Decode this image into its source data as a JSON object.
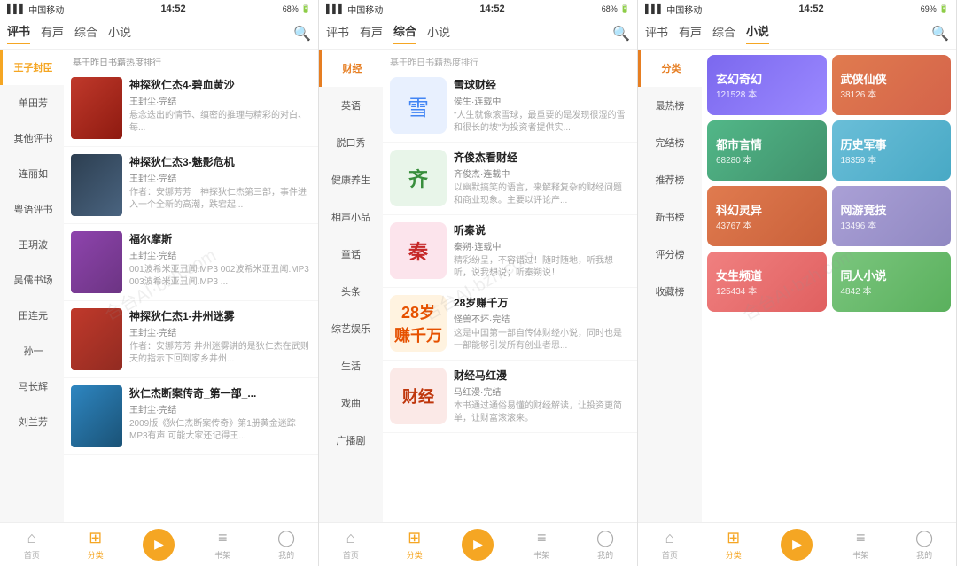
{
  "panels": [
    {
      "id": "panel1",
      "status": {
        "carrier": "中国移动",
        "time": "14:52",
        "battery": "68%",
        "signal": "●●●"
      },
      "tabs": [
        "评书",
        "有声",
        "综合",
        "小说"
      ],
      "active_tab": "评书",
      "section_hint": "基于昨日书籍热度排行",
      "sidebar": [
        {
          "label": "王子封臣",
          "active": true
        },
        {
          "label": "单田芳"
        },
        {
          "label": "其他评书"
        },
        {
          "label": "连丽如"
        },
        {
          "label": "粤语评书"
        },
        {
          "label": "王玥波"
        },
        {
          "label": "吴儒书场"
        },
        {
          "label": "田连元"
        },
        {
          "label": "孙一"
        },
        {
          "label": "马长辉"
        },
        {
          "label": "刘兰芳"
        }
      ],
      "books": [
        {
          "title": "神探狄仁杰4-碧血黄沙",
          "author": "王封尘·完结",
          "desc": "悬念迭出的情节、缜密的推理与精彩的对白、每...",
          "cover_class": "cover-1"
        },
        {
          "title": "神探狄仁杰3-魅影危机",
          "author": "王封尘·完结",
          "desc": "作者：安娜芳芳　神探狄仁杰第三部，事件进入一个全新的高潮，跌宕起...",
          "cover_class": "cover-2"
        },
        {
          "title": "福尔摩斯",
          "author": "王封尘·完结",
          "desc": "001波希米亚丑闻.MP3 002波希米亚丑闻.MP3 003波希米亚丑闻.MP3 ...",
          "cover_class": "cover-3"
        },
        {
          "title": "神探狄仁杰1-井州迷雾",
          "author": "王封尘·完结",
          "desc": "作者：安娜芳芳 井州迷雾讲的是狄仁杰在武则天的指示下回到家乡井州...",
          "cover_class": "cover-4"
        },
        {
          "title": "狄仁杰断案传奇_第一部_...",
          "author": "王封尘·完结",
          "desc": "2009版《狄仁杰断案传奇》第1册黄金迷踪MP3有声 可能大家还记得王...",
          "cover_class": "cover-5"
        }
      ]
    },
    {
      "id": "panel2",
      "status": {
        "carrier": "中国移动",
        "time": "14:52",
        "battery": "68%",
        "signal": "●●●"
      },
      "tabs": [
        "评书",
        "有声",
        "综合",
        "小说"
      ],
      "active_tab": "综合",
      "section_hint": "基于昨日书籍热度排行",
      "categories": [
        {
          "label": "财经",
          "active": true
        },
        {
          "label": "英语"
        },
        {
          "label": "脱口秀"
        },
        {
          "label": "健康养生"
        },
        {
          "label": "相声小品"
        },
        {
          "label": "童话"
        },
        {
          "label": "头条"
        },
        {
          "label": "综艺娱乐"
        },
        {
          "label": "生活"
        },
        {
          "label": "戏曲"
        },
        {
          "label": "广播剧"
        }
      ],
      "books": [
        {
          "title": "雪球财经",
          "meta": "侯生·连载中",
          "desc": "\"人生就像滚雪球，最重要的是发现很湿的雪和很长的坡\"为投资者提供实...",
          "cover_type": "xueqiu"
        },
        {
          "title": "齐俊杰看财经",
          "meta": "齐俊杰·连载中",
          "desc": "以幽默搞笑的语言，来解释复杂的财经问题和商业现象。主要以评论产...",
          "cover_type": "qijun"
        },
        {
          "title": "听秦说",
          "meta": "秦朔·连载中",
          "desc": "精彩纷呈，不容错过！随时随地，听我想听，说我想说；听秦朔说！",
          "cover_type": "tingqin"
        },
        {
          "title": "28岁赚千万",
          "meta": "怪兽不坏·完结",
          "desc": "这是中国第一部自传体财经小说，同时也是一部能够引发所有创业者思...",
          "cover_type": "28sui"
        },
        {
          "title": "财经马红漫",
          "meta": "马红漫·完结",
          "desc": "本书通过通俗易懂的财经解读，让投资更简单，让财富滚滚来。",
          "cover_type": "mahong"
        }
      ]
    },
    {
      "id": "panel3",
      "status": {
        "carrier": "中国移动",
        "time": "14:52",
        "battery": "69%",
        "signal": "●●●"
      },
      "tabs": [
        "评书",
        "有声",
        "综合",
        "小说"
      ],
      "active_tab": "小说",
      "categories": [
        {
          "label": "分类",
          "active": true
        },
        {
          "label": "最热榜"
        },
        {
          "label": "完结榜"
        },
        {
          "label": "推荐榜"
        },
        {
          "label": "新书榜"
        },
        {
          "label": "评分榜"
        },
        {
          "label": "收藏榜"
        }
      ],
      "grid": [
        {
          "title": "玄幻奇幻",
          "count": "121528 本",
          "bg": "card-bg-1"
        },
        {
          "title": "武侠仙侠",
          "count": "38126 本",
          "bg": "card-bg-2"
        },
        {
          "title": "都市言情",
          "count": "68280 本",
          "bg": "card-bg-3"
        },
        {
          "title": "历史军事",
          "count": "18359 本",
          "bg": "card-bg-4"
        },
        {
          "title": "科幻灵异",
          "count": "43767 本",
          "bg": "card-bg-5"
        },
        {
          "title": "网游竞技",
          "count": "13496 本",
          "bg": "card-bg-6"
        },
        {
          "title": "女生频道",
          "count": "125434 本",
          "bg": "card-bg-9"
        },
        {
          "title": "同人小说",
          "count": "4842 本",
          "bg": "card-bg-10"
        }
      ]
    }
  ],
  "bottom_nav": {
    "items": [
      {
        "label": "首页",
        "icon": "⌂",
        "active": false
      },
      {
        "label": "分类",
        "icon": "⊞",
        "active": true
      },
      {
        "label": "play",
        "icon": "▶",
        "active": false
      },
      {
        "label": "书架",
        "icon": "📚",
        "active": false
      },
      {
        "label": "我的",
        "icon": "○",
        "active": false
      }
    ]
  }
}
